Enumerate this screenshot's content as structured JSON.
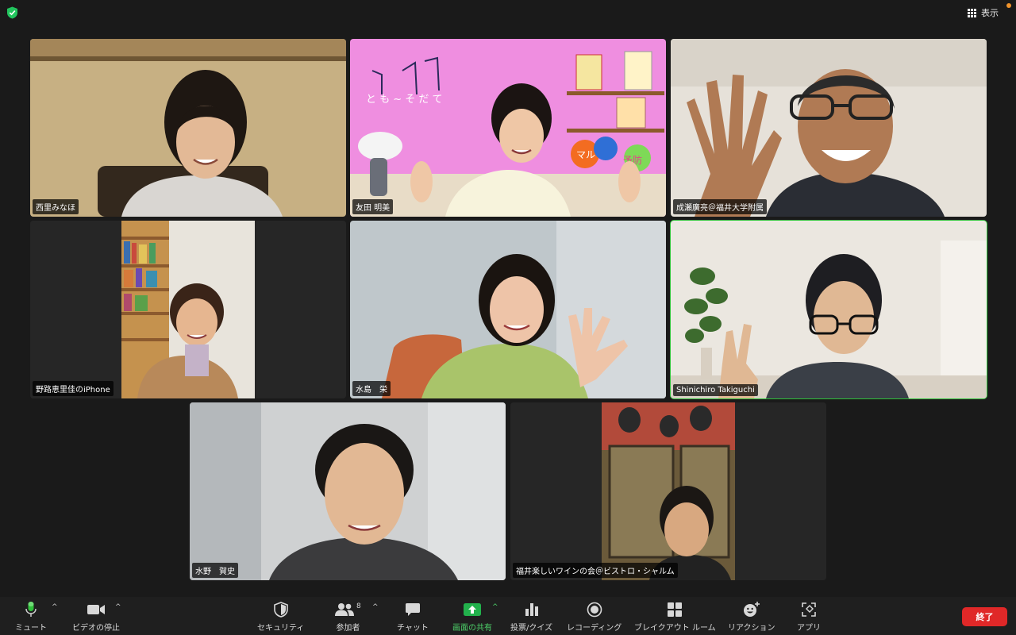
{
  "topbar": {
    "view_label": "表示"
  },
  "participants": [
    {
      "name": "西里みなほ"
    },
    {
      "name": "友田 明美"
    },
    {
      "name": "成瀬廣亮＠福井大学附属"
    },
    {
      "name": "野路恵里佳のiPhone"
    },
    {
      "name": "水島　栄"
    },
    {
      "name": "Shinichiro Takiguchi",
      "active": true
    },
    {
      "name": "水野　賀史"
    },
    {
      "name": "福井楽しいワインの会＠ビストロ・シャルム"
    }
  ],
  "virtual_background": {
    "wave_text": "と も ~ そ だ て",
    "badge_text_1": "マル",
    "badge_text_2": "予防"
  },
  "toolbar": {
    "mute": "ミュート",
    "video_stop": "ビデオの停止",
    "security": "セキュリティ",
    "participants": "参加者",
    "participants_count": "8",
    "chat": "チャット",
    "share_screen": "画面の共有",
    "polls": "投票/クイズ",
    "recording": "レコーディング",
    "breakout": "ブレイクアウト ルーム",
    "reactions": "リアクション",
    "apps": "アプリ",
    "end": "終了"
  },
  "colors": {
    "active_speaker": "#2fbf3a",
    "share_green": "#22b14c",
    "end_red": "#e02828",
    "shield_green": "#22c55e"
  }
}
